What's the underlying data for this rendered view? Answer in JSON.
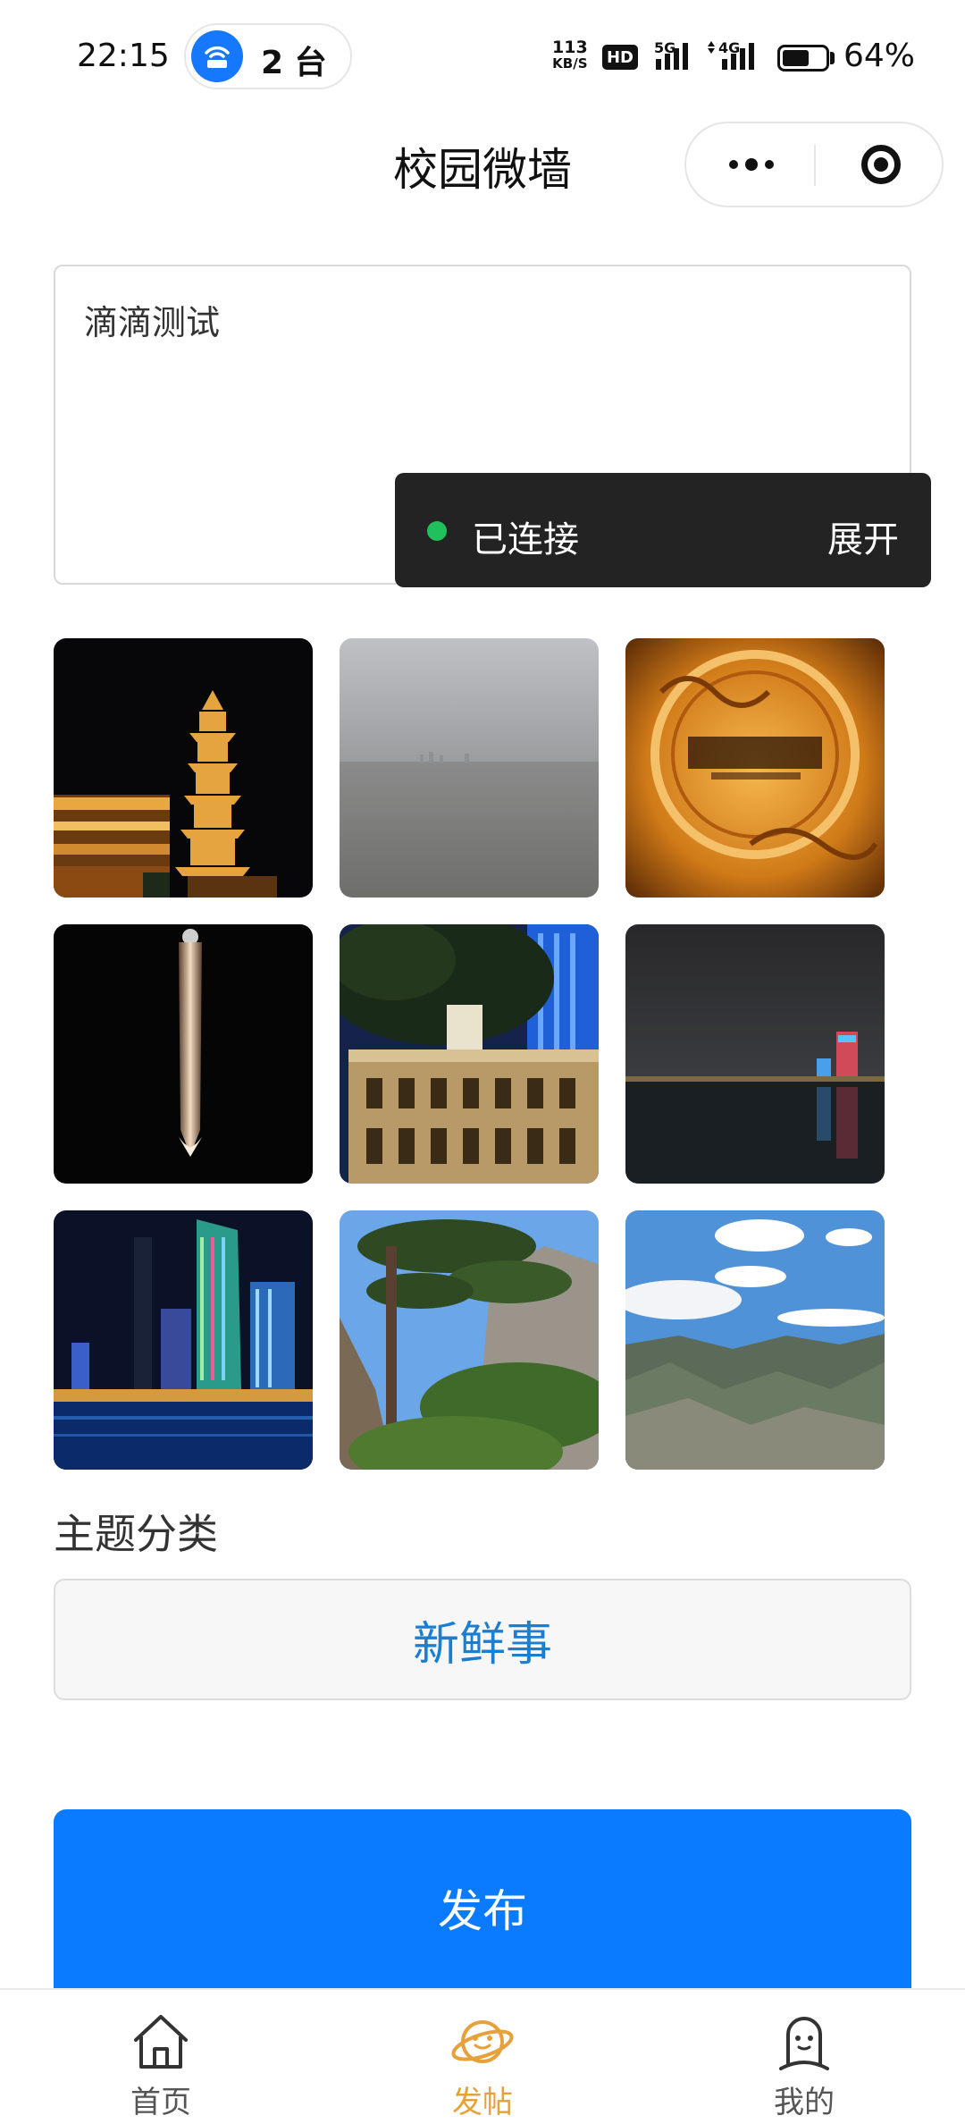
{
  "status_bar": {
    "time": "22:15",
    "hotspot_count": "2 台",
    "net_speed_value": "113",
    "net_speed_unit": "KB/S",
    "hd_label": "HD",
    "signal_5g_label": "5G",
    "signal_4g_label": "4G",
    "battery_percent": "64%",
    "battery_level": 0.64
  },
  "nav": {
    "title": "校园微墙"
  },
  "post": {
    "text": "滴滴测试"
  },
  "toast": {
    "status": "已连接",
    "action": "展开"
  },
  "photos": [
    {
      "name": "pagoda-night"
    },
    {
      "name": "lake-overcast"
    },
    {
      "name": "bronze-plaque"
    },
    {
      "name": "lit-tower"
    },
    {
      "name": "heritage-building"
    },
    {
      "name": "river-night"
    },
    {
      "name": "skyscraper-lights"
    },
    {
      "name": "welcoming-pine"
    },
    {
      "name": "mountain-clouds"
    }
  ],
  "category": {
    "label": "主题分类",
    "value": "新鲜事"
  },
  "publish": {
    "label": "发布"
  },
  "tabs": [
    {
      "label": "首页",
      "icon": "home-icon",
      "active": false
    },
    {
      "label": "发帖",
      "icon": "planet-icon",
      "active": true
    },
    {
      "label": "我的",
      "icon": "profile-icon",
      "active": false
    }
  ],
  "colors": {
    "accent": "#0a7bff",
    "tab_active": "#e6a13a",
    "category_text": "#1a7fd0",
    "connected": "#20c05c"
  }
}
